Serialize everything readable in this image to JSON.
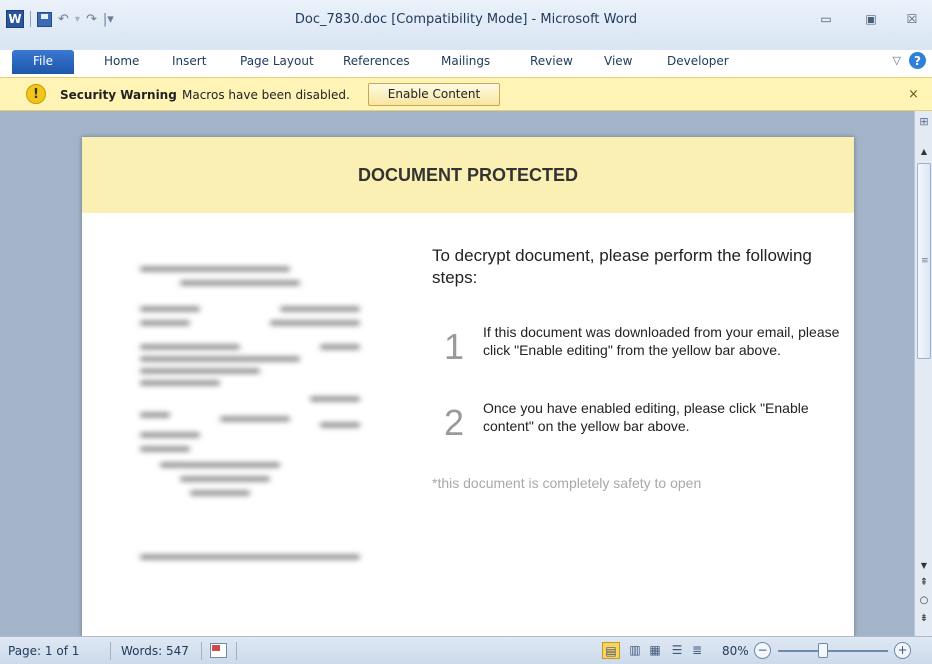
{
  "window": {
    "title": "Doc_7830.doc [Compatibility Mode] - Microsoft Word",
    "app_icon_letter": "W",
    "controls": {
      "minimize": "▭",
      "restore": "▣",
      "close": "☒"
    }
  },
  "quick_access": {
    "undo": "↶",
    "redo": "↷",
    "customize": "|▾"
  },
  "ribbon": {
    "tabs": [
      "File",
      "Home",
      "Insert",
      "Page Layout",
      "References",
      "Mailings",
      "Review",
      "View",
      "Developer"
    ],
    "active_tab": "File",
    "minimize_icon": "▽",
    "help_label": "?"
  },
  "security_bar": {
    "icon": "!",
    "title": "Security Warning",
    "message": "Macros have been disabled.",
    "button_label": "Enable Content",
    "close_label": "×"
  },
  "document": {
    "heading": "DOCUMENT PROTECTED",
    "intro": "To decrypt document, please perform the following steps:",
    "steps": [
      {
        "number": "1",
        "text": "If this document was downloaded from your email, please click \"Enable editing\" from the yellow bar above."
      },
      {
        "number": "2",
        "text": "Once you have enabled editing, please click \"Enable content\" on the yellow bar above."
      }
    ],
    "note": "*this document is completely safety to open"
  },
  "status_bar": {
    "page": "Page: 1 of 1",
    "words": "Words: 547",
    "zoom": "80%",
    "zoom_out_label": "−",
    "zoom_in_label": "+"
  },
  "colors": {
    "security_bar_bg": "#fff4b5",
    "doc_header_bg": "#fbf0b4",
    "file_tab": "#1d57ab",
    "workspace_bg": "#a3b3c8"
  }
}
